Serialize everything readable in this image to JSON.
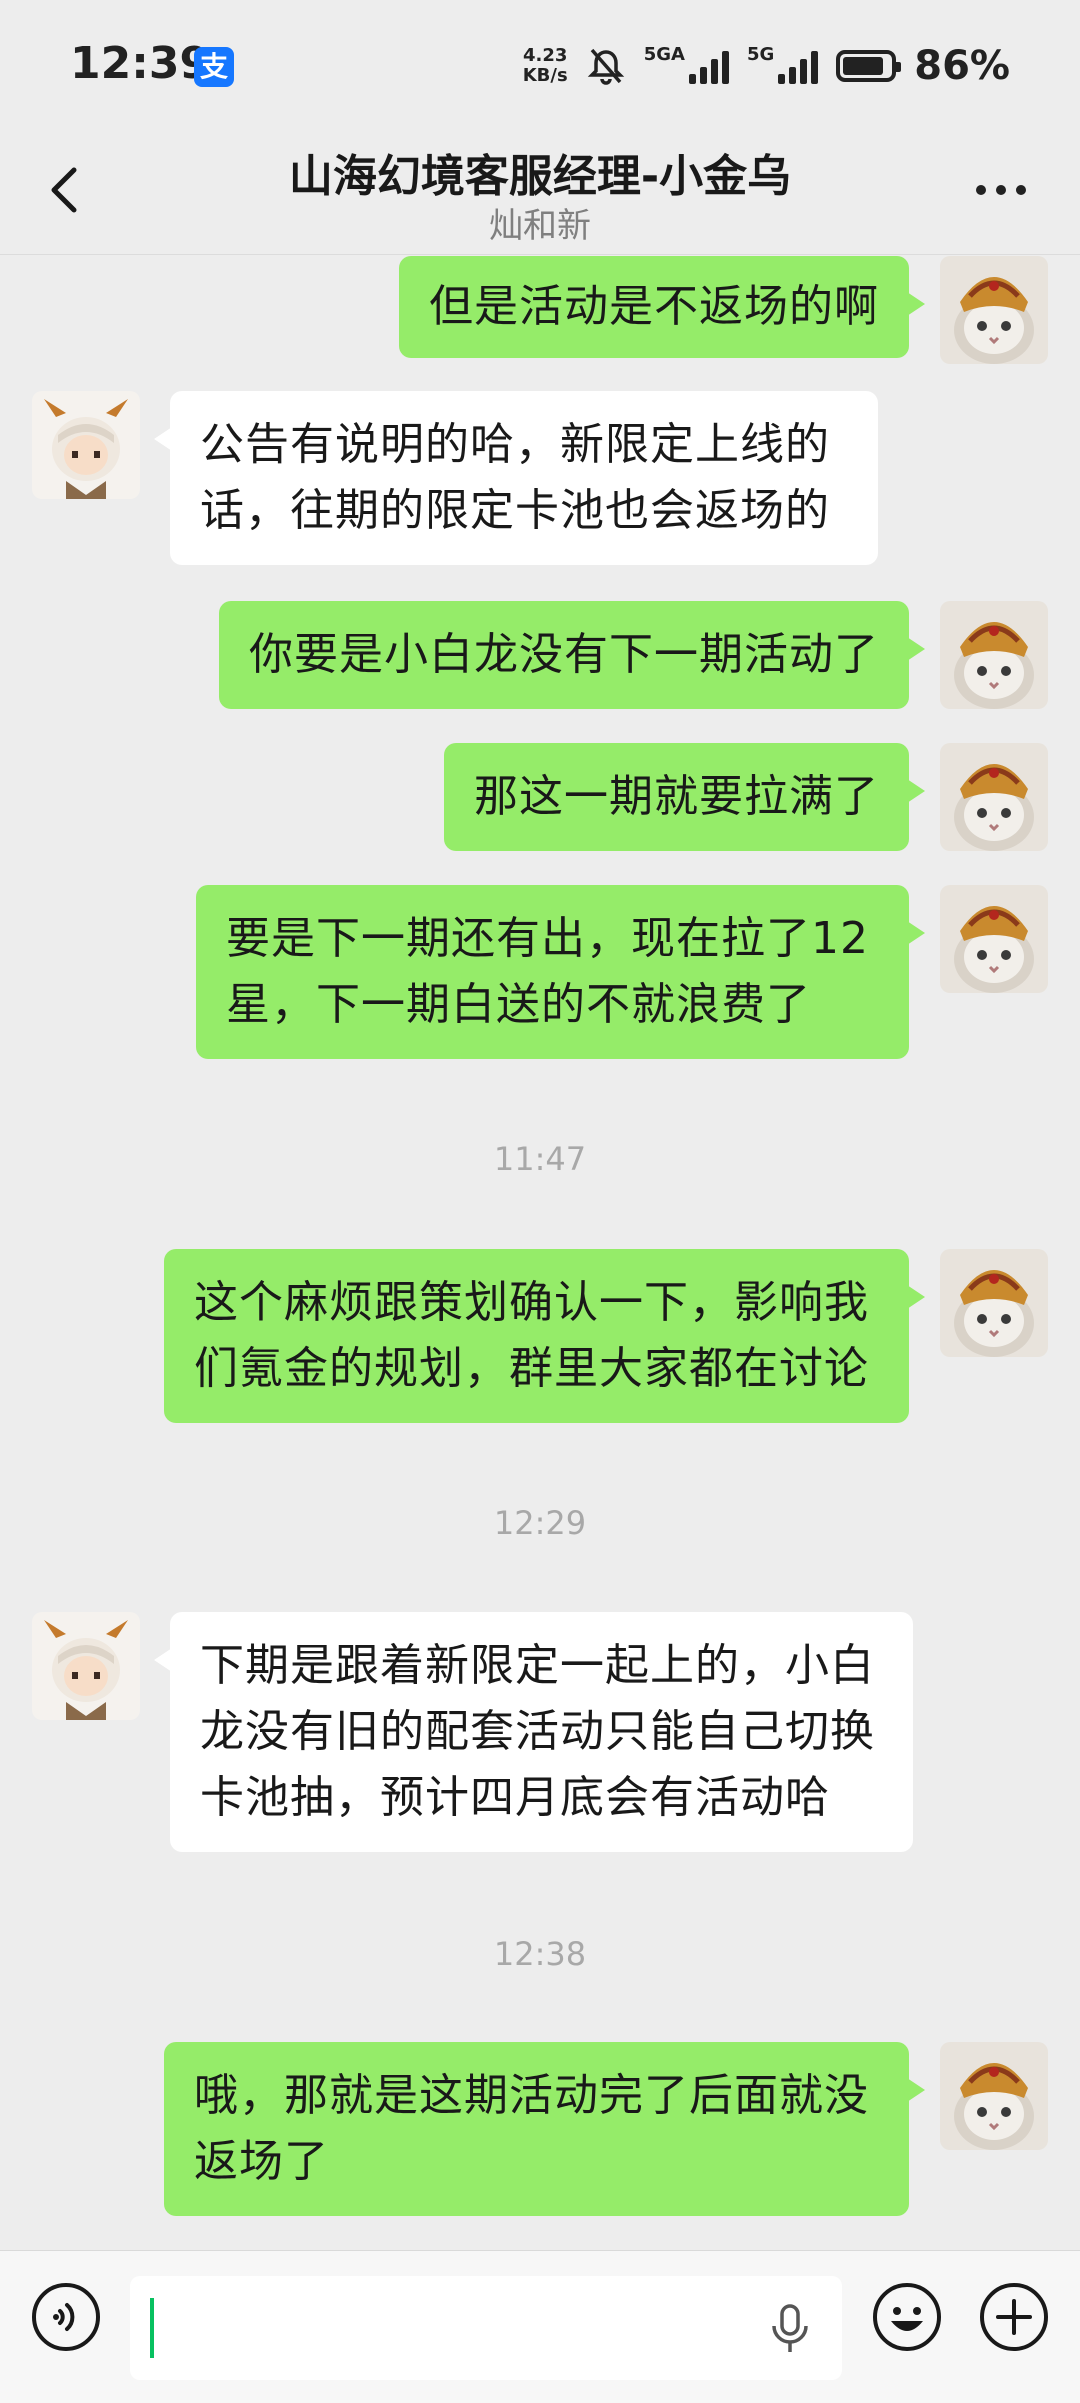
{
  "status_bar": {
    "time": "12:39",
    "alipay_glyph": "支",
    "net_speed_value": "4.23",
    "net_speed_unit": "KB/s",
    "signal1_label": "5GA",
    "signal2_label": "5G",
    "battery_percent": "86%",
    "battery_level": 0.86,
    "icons": [
      "alipay-icon",
      "mute-bell-icon",
      "signal-icon",
      "battery-icon"
    ]
  },
  "header": {
    "title": "山海幻境客服经理-小金乌",
    "subtitle": "灿和新",
    "icons": [
      "back-chevron-icon",
      "more-dots-icon"
    ]
  },
  "messages": [
    {
      "sender": "me",
      "text": "但是活动是不返场的啊"
    },
    {
      "sender": "them",
      "text": "公告有说明的哈，新限定上线的话，往期的限定卡池也会返场的"
    },
    {
      "sender": "me",
      "text": "你要是小白龙没有下一期活动了"
    },
    {
      "sender": "me",
      "text": "那这一期就要拉满了"
    },
    {
      "sender": "me",
      "text": "要是下一期还有出，现在拉了12星，下一期白送的不就浪费了"
    },
    {
      "type": "time",
      "text": "11:47"
    },
    {
      "sender": "me",
      "text": "这个麻烦跟策划确认一下，影响我们氪金的规划，群里大家都在讨论"
    },
    {
      "type": "time",
      "text": "12:29"
    },
    {
      "sender": "them",
      "text": "下期是跟着新限定一起上的，小白龙没有旧的配套活动只能自己切换卡池抽，预计四月底会有活动哈"
    },
    {
      "type": "time",
      "text": "12:38"
    },
    {
      "sender": "me",
      "text": "哦，那就是这期活动完了后面就没返场了"
    }
  ],
  "input_bar": {
    "value": "",
    "icons": [
      "voice-icon",
      "microphone-icon",
      "emoji-icon",
      "plus-icon"
    ]
  },
  "colors": {
    "background": "#ededed",
    "my_bubble": "#95ec69",
    "their_bubble": "#ffffff",
    "caret": "#07c160",
    "alipay": "#1677ff"
  }
}
